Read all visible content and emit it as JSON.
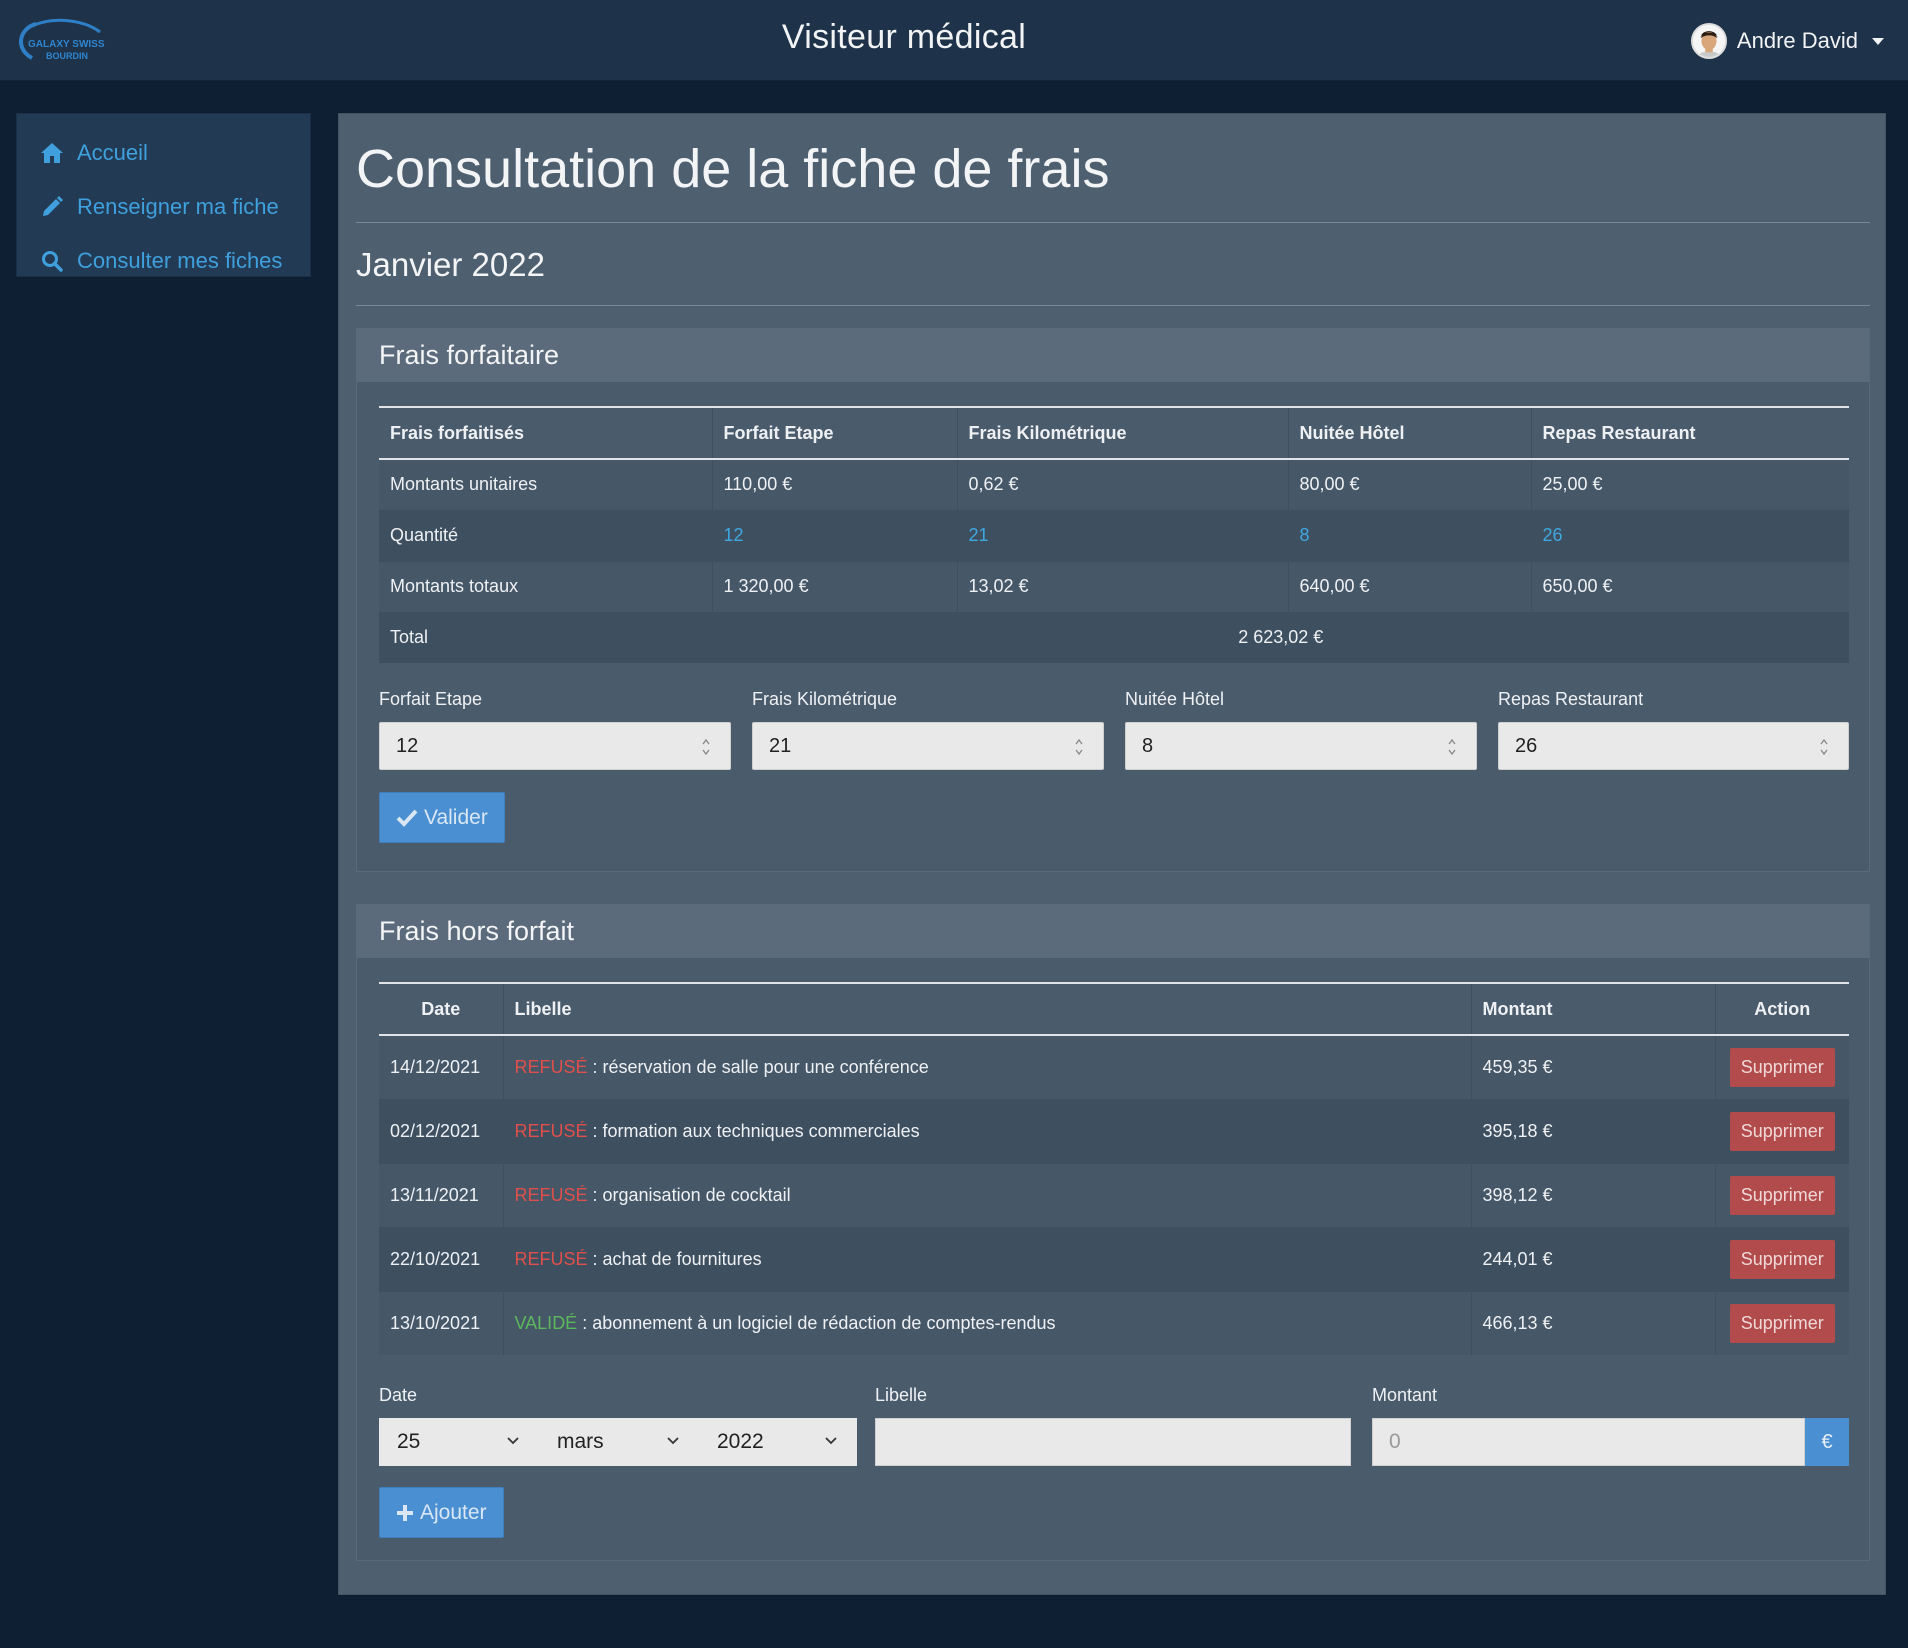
{
  "header": {
    "logo_line1": "GALAXY SWISS",
    "logo_line2": "BOURDIN",
    "title": "Visiteur médical",
    "user_name": "Andre David"
  },
  "sidebar": {
    "items": [
      {
        "label": "Accueil",
        "icon": "home-icon"
      },
      {
        "label": "Renseigner ma fiche",
        "icon": "pencil-icon"
      },
      {
        "label": "Consulter mes fiches",
        "icon": "search-icon"
      }
    ]
  },
  "main": {
    "page_title": "Consultation de la fiche de frais",
    "period": "Janvier 2022"
  },
  "forfait": {
    "heading": "Frais forfaitaire",
    "columns": [
      "Frais forfaitisés",
      "Forfait Etape",
      "Frais Kilométrique",
      "Nuitée Hôtel",
      "Repas Restaurant"
    ],
    "rows": [
      [
        "Montants unitaires",
        "110,00 €",
        "0,62 €",
        "80,00 €",
        "25,00 €"
      ],
      [
        "Quantité",
        "12",
        "21",
        "8",
        "26"
      ],
      [
        "Montants totaux",
        "1 320,00 €",
        "13,02 €",
        "640,00 €",
        "650,00 €"
      ]
    ],
    "total_label": "Total",
    "total_value": "2 623,02 €",
    "form": {
      "fields": [
        {
          "label": "Forfait Etape",
          "value": "12"
        },
        {
          "label": "Frais Kilométrique",
          "value": "21"
        },
        {
          "label": "Nuitée Hôtel",
          "value": "8"
        },
        {
          "label": "Repas Restaurant",
          "value": "26"
        }
      ],
      "submit_label": "Valider"
    }
  },
  "hors_forfait": {
    "heading": "Frais hors forfait",
    "columns": [
      "Date",
      "Libelle",
      "Montant",
      "Action"
    ],
    "rows": [
      {
        "date": "14/12/2021",
        "status": "REFUSÉ",
        "libelle": " : réservation de salle pour une conférence",
        "montant": "459,35 €",
        "action": "Supprimer"
      },
      {
        "date": "02/12/2021",
        "status": "REFUSÉ",
        "libelle": " : formation aux techniques commerciales",
        "montant": "395,18 €",
        "action": "Supprimer"
      },
      {
        "date": "13/11/2021",
        "status": "REFUSÉ",
        "libelle": " : organisation de cocktail",
        "montant": "398,12 €",
        "action": "Supprimer"
      },
      {
        "date": "22/10/2021",
        "status": "REFUSÉ",
        "libelle": " : achat de fournitures",
        "montant": "244,01 €",
        "action": "Supprimer"
      },
      {
        "date": "13/10/2021",
        "status": "VALIDÉ",
        "libelle": " : abonnement à un logiciel de rédaction de comptes-rendus",
        "montant": "466,13 €",
        "action": "Supprimer"
      }
    ],
    "form": {
      "date_label": "Date",
      "day": "25",
      "month": "mars",
      "year": "2022",
      "libelle_label": "Libelle",
      "libelle_value": "",
      "montant_label": "Montant",
      "montant_placeholder": "0",
      "currency": "€",
      "submit_label": "Ajouter"
    }
  },
  "colors": {
    "accent": "#4a8fd1",
    "link": "#3fa0dd",
    "refused": "#e0504a",
    "validated": "#5cb85c",
    "danger_button": "#b24c4c"
  }
}
